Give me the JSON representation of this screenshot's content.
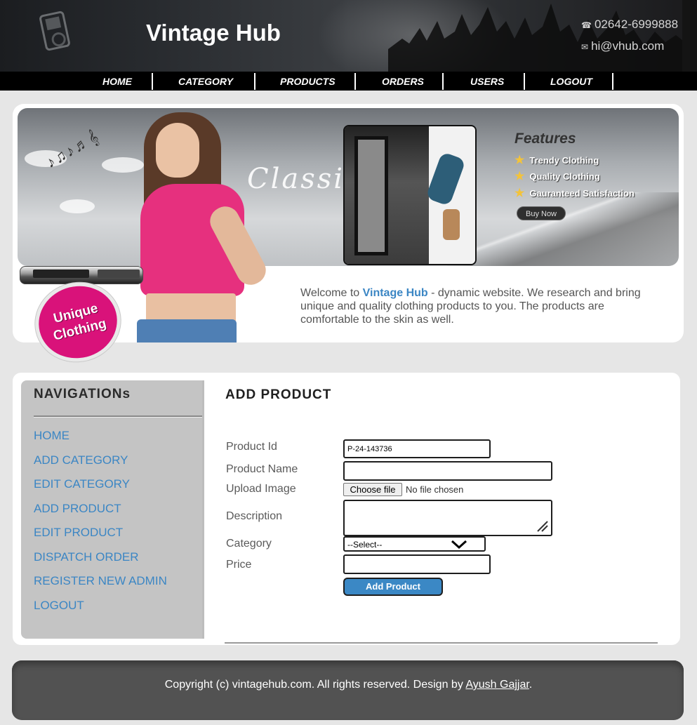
{
  "header": {
    "site_title": "Vintage Hub",
    "phone": "02642-6999888",
    "email": "hi@vhub.com"
  },
  "nav": {
    "items": [
      {
        "label": "HOME"
      },
      {
        "label": "CATEGORY"
      },
      {
        "label": "PRODUCTS"
      },
      {
        "label": "ORDERS"
      },
      {
        "label": "USERS"
      },
      {
        "label": "LOGOUT"
      }
    ]
  },
  "banner": {
    "classic_text": "Classic",
    "badge_line1": "Unique",
    "badge_line2": "Clothing",
    "features_title": "Features",
    "features": [
      "Trendy Clothing",
      "Quality Clothing",
      "Gauranteed Satisfaction"
    ],
    "buy_now": "Buy Now",
    "welcome_prefix": "Welcome to ",
    "welcome_name": "Vintage Hub",
    "welcome_rest": " - dynamic website. We research and bring unique and quality clothing products to you. The products are comfortable to the skin as well."
  },
  "sidebar": {
    "title": "NAVIGATIONs",
    "items": [
      {
        "label": "HOME"
      },
      {
        "label": "ADD CATEGORY"
      },
      {
        "label": "EDIT CATEGORY"
      },
      {
        "label": "ADD PRODUCT"
      },
      {
        "label": "EDIT PRODUCT"
      },
      {
        "label": "DISPATCH ORDER"
      },
      {
        "label": "REGISTER NEW ADMIN"
      },
      {
        "label": "LOGOUT"
      }
    ]
  },
  "form": {
    "title": "ADD PRODUCT",
    "product_id_label": "Product Id",
    "product_id_value": "P-24-143736",
    "product_name_label": "Product Name",
    "upload_image_label": "Upload Image",
    "choose_file": "Choose file",
    "no_file": "No file chosen",
    "description_label": "Description",
    "category_label": "Category",
    "category_selected": "--Select--",
    "price_label": "Price",
    "submit_label": "Add Product"
  },
  "footer": {
    "text": "Copyright (c) vintagehub.com. All rights reserved. Design by ",
    "author": "Ayush Gajjar",
    "end": "."
  },
  "colors": {
    "accent": "#3b86c4",
    "badge": "#d9127a",
    "footer": "#525252"
  }
}
